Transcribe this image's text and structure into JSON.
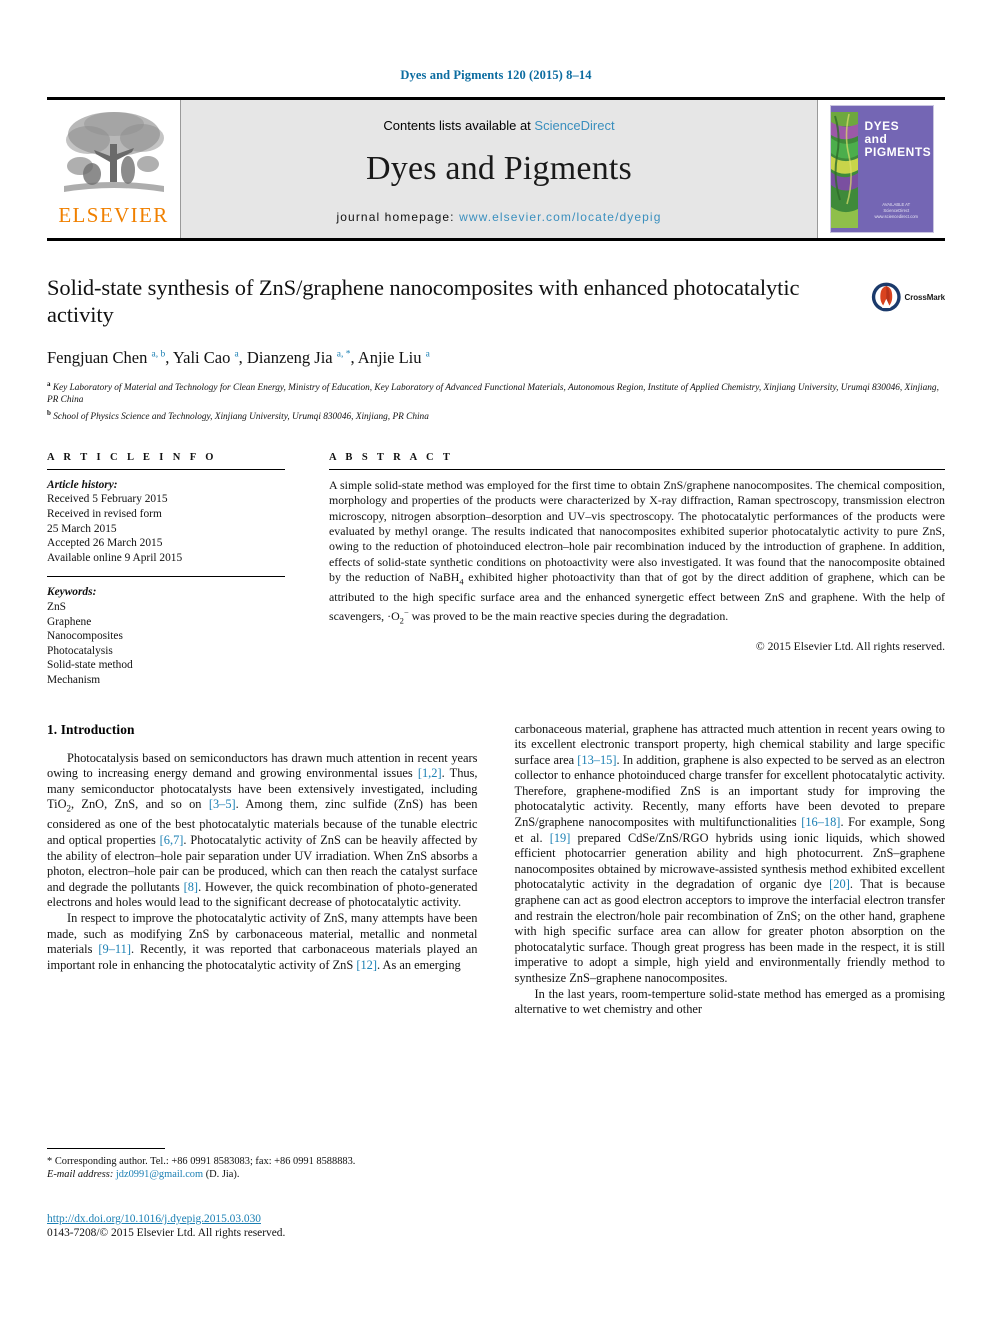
{
  "running_head": "Dyes and Pigments 120 (2015) 8–14",
  "masthead": {
    "contents_prefix": "Contents lists available at ",
    "sciencedirect": "ScienceDirect",
    "journal_name": "Dyes and Pigments",
    "homepage_label": "journal homepage:",
    "homepage_url": "www.elsevier.com/locate/dyepig",
    "publisher_wordmark": "ELSEVIER",
    "cover": {
      "line1": "DYES",
      "line2": "and",
      "line3": "PIGMENTS",
      "foot1": "AVAILABLE AT",
      "foot2": "ScienceDirect",
      "foot3": "www.sciencedirect.com"
    }
  },
  "article": {
    "title": "Solid-state synthesis of ZnS/graphene nanocomposites with enhanced photocatalytic activity",
    "crossmark_label": "CrossMark",
    "authors_html": "Fengjuan Chen <sup>a, b</sup>, Yali Cao <sup>a</sup>, Dianzeng Jia <sup>a, *</sup>, Anjie Liu <sup>a</sup>",
    "affiliation_a": "Key Laboratory of Material and Technology for Clean Energy, Ministry of Education, Key Laboratory of Advanced Functional Materials, Autonomous Region, Institute of Applied Chemistry, Xinjiang University, Urumqi 830046, Xinjiang, PR China",
    "affiliation_b": "School of Physics Science and Technology, Xinjiang University, Urumqi 830046, Xinjiang, PR China"
  },
  "article_info": {
    "heading": "A R T I C L E  I N F O",
    "history_label": "Article history:",
    "history": [
      "Received 5 February 2015",
      "Received in revised form",
      "25 March 2015",
      "Accepted 26 March 2015",
      "Available online 9 April 2015"
    ],
    "keywords_label": "Keywords:",
    "keywords": [
      "ZnS",
      "Graphene",
      "Nanocomposites",
      "Photocatalysis",
      "Solid-state method",
      "Mechanism"
    ]
  },
  "abstract": {
    "heading": "A B S T R A C T",
    "text": "A simple solid-state method was employed for the first time to obtain ZnS/graphene nanocomposites. The chemical composition, morphology and properties of the products were characterized by X-ray diffraction, Raman spectroscopy, transmission electron microscopy, nitrogen absorption–desorption and UV–vis spectroscopy. The photocatalytic performances of the products were evaluated by methyl orange. The results indicated that nanocomposites exhibited superior photocatalytic activity to pure ZnS, owing to the reduction of photoinduced electron–hole pair recombination induced by the introduction of graphene. In addition, effects of solid-state synthetic conditions on photoactivity were also investigated. It was found that the nanocomposite obtained by the reduction of NaBH4 exhibited higher photoactivity than that of got by the direct addition of graphene, which can be attributed to the high specific surface area and the enhanced synergetic effect between ZnS and graphene. With the help of scavengers, ·O2− was proved to be the main reactive species during the degradation.",
    "copyright": "© 2015 Elsevier Ltd. All rights reserved."
  },
  "body": {
    "section_heading": "1. Introduction",
    "left_para_1": "Photocatalysis based on semiconductors has drawn much attention in recent years owing to increasing energy demand and growing environmental issues [1,2]. Thus, many semiconductor photocatalysts have been extensively investigated, including TiO2, ZnO, ZnS, and so on [3–5]. Among them, zinc sulfide (ZnS) has been considered as one of the best photocatalytic materials because of the tunable electric and optical properties [6,7]. Photocatalytic activity of ZnS can be heavily affected by the ability of electron–hole pair separation under UV irradiation. When ZnS absorbs a photon, electron–hole pair can be produced, which can then reach the catalyst surface and degrade the pollutants [8]. However, the quick recombination of photo-generated electrons and holes would lead to the significant decrease of photocatalytic activity.",
    "left_para_2": "In respect to improve the photocatalytic activity of ZnS, many attempts have been made, such as modifying ZnS by carbonaceous material, metallic and nonmetal materials [9–11]. Recently, it was reported that carbonaceous materials played an important role in enhancing the photocatalytic activity of ZnS [12]. As an emerging",
    "right_para_1": "carbonaceous material, graphene has attracted much attention in recent years owing to its excellent electronic transport property, high chemical stability and large specific surface area [13–15]. In addition, graphene is also expected to be served as an electron collector to enhance photoinduced charge transfer for excellent photocatalytic activity. Therefore, graphene-modified ZnS is an important study for improving the photocatalytic activity. Recently, many efforts have been devoted to prepare ZnS/graphene nanocomposites with multifunctionalities [16–18]. For example, Song et al. [19] prepared CdSe/ZnS/RGO hybrids using ionic liquids, which showed efficient photocarrier generation ability and high photocurrent. ZnS–graphene nanocomposites obtained by microwave-assisted synthesis method exhibited excellent photocatalytic activity in the degradation of organic dye [20]. That is because graphene can act as good electron acceptors to improve the interfacial electron transfer and restrain the electron/hole pair recombination of ZnS; on the other hand, graphene with high specific surface area can allow for greater photon absorption on the photocatalytic surface. Though great progress has been made in the respect, it is still imperative to adopt a simple, high yield and environmentally friendly method to synthesize ZnS–graphene nanocomposites.",
    "right_para_2": "In the last years, room-temperture solid-state method has emerged as a promising alternative to wet chemistry and other"
  },
  "footnote": {
    "marker": "*",
    "line1": "Corresponding author. Tel.: +86 0991 8583083; fax: +86 0991 8588883.",
    "email_label": "E-mail address:",
    "email": "jdz0991@gmail.com",
    "email_suffix": "(D. Jia)."
  },
  "doi": {
    "url": "http://dx.doi.org/10.1016/j.dyepig.2015.03.030",
    "issn_line": "0143-7208/© 2015 Elsevier Ltd. All rights reserved."
  },
  "colors": {
    "link": "#1a7fb3",
    "runhead": "#0b6ca0",
    "elsevier_orange": "#f08000",
    "cover_purple": "#7466b4",
    "masthead_bg": "#e6e6e6"
  }
}
